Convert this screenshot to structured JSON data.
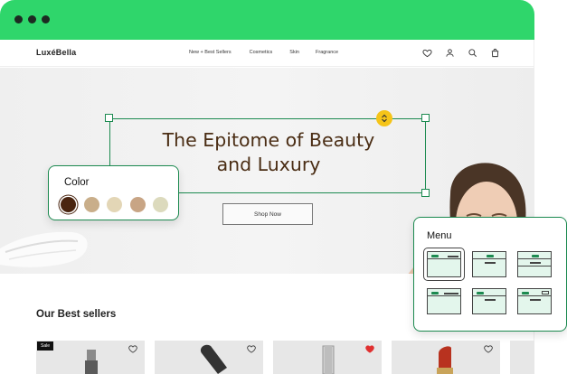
{
  "brand": {
    "logo": "LuxéBella"
  },
  "nav": {
    "links": [
      "New + Best Sellers",
      "Cosmetics",
      "Skin",
      "Fragrance"
    ],
    "icons": [
      "heart-icon",
      "user-icon",
      "search-icon",
      "bag-icon"
    ]
  },
  "hero": {
    "title_line1": "The Epitome of Beauty",
    "title_line2": "and Luxury",
    "cta": "Shop Now"
  },
  "color_panel": {
    "title": "Color",
    "swatches": [
      "#4a2510",
      "#c9ae8a",
      "#e3d6b6",
      "#c8a585",
      "#dcdabd"
    ],
    "selected_index": 0
  },
  "menu_panel": {
    "title": "Menu",
    "selected_index": 0
  },
  "best_sellers": {
    "title": "Our Best sellers",
    "products": [
      {
        "badge": "Sale",
        "favorited": false
      },
      {
        "badge": "",
        "favorited": false
      },
      {
        "badge": "",
        "favorited": true
      },
      {
        "badge": "",
        "favorited": false
      }
    ]
  },
  "colors": {
    "accent": "#2fd66b",
    "selection": "#1c8a50",
    "handle": "#f5c418",
    "heading": "#4a2d14",
    "favorite": "#e03030"
  }
}
